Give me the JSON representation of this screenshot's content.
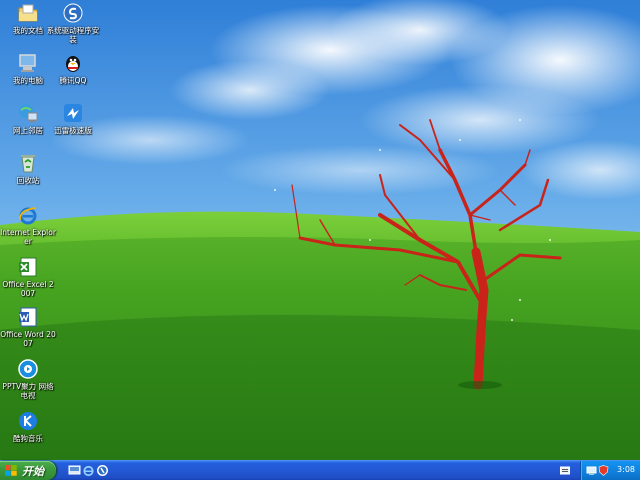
{
  "desktop": {
    "icons": [
      {
        "label": "我的文档",
        "icon": "folder-icon"
      },
      {
        "label": "系统驱动程序安装",
        "icon": "driver-setup-icon"
      },
      {
        "label": "我的电脑",
        "icon": "computer-icon"
      },
      {
        "label": "腾讯QQ",
        "icon": "qq-penguin-icon"
      },
      {
        "label": "网上邻居",
        "icon": "network-icon"
      },
      {
        "label": "迅雷极速版",
        "icon": "thunder-bird-icon"
      },
      {
        "label": "回收站",
        "icon": "recycle-bin-icon"
      },
      {
        "label": "Internet Explorer",
        "icon": "internet-explorer-icon"
      },
      {
        "label": "Office Excel 2007",
        "icon": "excel-icon"
      },
      {
        "label": "Office Word 2007",
        "icon": "word-icon"
      },
      {
        "label": "PPTV聚力 网络电视",
        "icon": "pptv-icon"
      },
      {
        "label": "酷狗音乐",
        "icon": "kugou-icon"
      }
    ]
  },
  "taskbar": {
    "start_label": "开始",
    "clock": "3:08"
  }
}
